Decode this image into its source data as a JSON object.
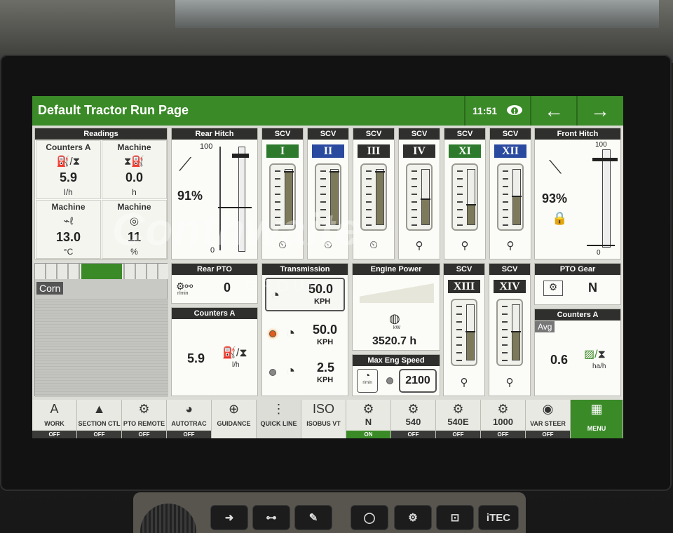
{
  "header": {
    "title": "Default Tractor Run Page",
    "time": "11:51",
    "back_icon": "arrow-left-icon",
    "forward_icon": "arrow-right-icon"
  },
  "readings": {
    "title": "Readings",
    "cells": [
      {
        "label": "Counters A",
        "value": "5.9",
        "unit": "l/h"
      },
      {
        "label": "Machine",
        "value": "0.0",
        "unit": "h"
      },
      {
        "label": "Machine",
        "value": "13.0",
        "unit": "°C"
      },
      {
        "label": "Machine",
        "value": "11",
        "unit": "%"
      }
    ]
  },
  "rear_hitch": {
    "title": "Rear Hitch",
    "percent": "91%",
    "scale_max": "100",
    "scale_min": "0",
    "level": 0.91
  },
  "scv": [
    {
      "title": "SCV",
      "name": "I",
      "color": "#2d7a2d",
      "level": 0.95
    },
    {
      "title": "SCV",
      "name": "II",
      "color": "#2a4aa0",
      "level": 0.95
    },
    {
      "title": "SCV",
      "name": "III",
      "color": "#2f2f2d",
      "level": 0.95
    },
    {
      "title": "SCV",
      "name": "IV",
      "color": "#2f2f2d",
      "level": 0.45
    },
    {
      "title": "SCV",
      "name": "XI",
      "color": "#2d7a2d",
      "level": 0.35
    },
    {
      "title": "SCV",
      "name": "XII",
      "color": "#2a4aa0",
      "level": 0.5
    }
  ],
  "scv_lower": [
    {
      "title": "SCV",
      "name": "XIII",
      "color": "#2f2f2d",
      "level": 0.5
    },
    {
      "title": "SCV",
      "name": "XIV",
      "color": "#2f2f2d",
      "level": 0.5
    }
  ],
  "front_hitch": {
    "title": "Front Hitch",
    "percent": "93%",
    "scale_max": "100",
    "scale_min": "0",
    "level": 0.93
  },
  "map": {
    "crop": "Corn"
  },
  "rear_pto": {
    "title": "Rear PTO",
    "value": "0",
    "unit": "r/min"
  },
  "counters_a": {
    "title": "Counters A",
    "value": "5.9",
    "unit": "l/h"
  },
  "transmission": {
    "title": "Transmission",
    "set_speed": "50.0",
    "set_unit": "KPH",
    "range2": "50.0",
    "range2_unit": "KPH",
    "range1": "2.5",
    "range1_unit": "KPH"
  },
  "engine_power": {
    "title": "Engine Power",
    "hours": "3520.7 h",
    "unit": "kW"
  },
  "max_eng_speed": {
    "title": "Max Eng Speed",
    "value": "2100",
    "unit": "r/min"
  },
  "pto_gear": {
    "title": "PTO Gear",
    "value": "N"
  },
  "counters_a2": {
    "title": "Counters A",
    "tag": "Avg",
    "value": "0.6",
    "unit": "ha/h"
  },
  "bottom_bar": [
    {
      "label": "WORK",
      "state": "OFF",
      "icon": "A"
    },
    {
      "label": "SECTION CTL",
      "state": "OFF",
      "icon": "▲"
    },
    {
      "label": "PTO REMOTE",
      "state": "OFF",
      "icon": "⚙"
    },
    {
      "label": "AUTOTRAC",
      "state": "OFF",
      "icon": "◕"
    },
    {
      "label": "GUIDANCE",
      "state": "",
      "icon": "⊕"
    },
    {
      "label": "QUICK LINE",
      "state": "",
      "icon": "⋮"
    },
    {
      "label": "ISOBUS VT",
      "state": "",
      "icon": "ISO"
    },
    {
      "label": "N",
      "state": "ON",
      "icon": "⚙"
    },
    {
      "label": "540",
      "state": "OFF",
      "icon": "⚙"
    },
    {
      "label": "540E",
      "state": "OFF",
      "icon": "⚙"
    },
    {
      "label": "1000",
      "state": "OFF",
      "icon": "⚙"
    },
    {
      "label": "VAR STEER",
      "state": "OFF",
      "icon": "◉"
    },
    {
      "label": "MENU",
      "state": "",
      "icon": "▦"
    }
  ],
  "hardware": {
    "buttons": [
      "➜",
      "⊶",
      "✎",
      "◯",
      "⚙",
      "⊡",
      "iTEC"
    ]
  },
  "watermark": {
    "text": "Conthwaite",
    "sub": "GROUP"
  }
}
